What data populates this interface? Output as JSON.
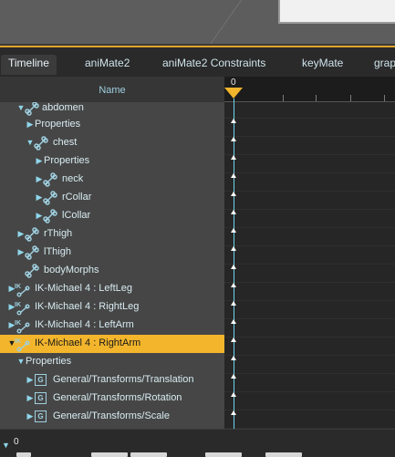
{
  "tabs": [
    {
      "label": "Timeline",
      "active": true
    },
    {
      "label": "aniMate2",
      "active": false
    },
    {
      "label": "aniMate2 Constraints",
      "active": false
    },
    {
      "label": "keyMate",
      "active": false
    },
    {
      "label": "grap",
      "active": false
    }
  ],
  "tree": {
    "header": "Name",
    "rows": [
      {
        "label": "abdomen",
        "expanded": true,
        "icon": "bone-icon"
      },
      {
        "label": "Properties",
        "expanded": false,
        "icon": ""
      },
      {
        "label": "chest",
        "expanded": true,
        "icon": "bone-icon"
      },
      {
        "label": "Properties",
        "expanded": false,
        "icon": ""
      },
      {
        "label": "neck",
        "expanded": false,
        "icon": "bone-icon"
      },
      {
        "label": "rCollar",
        "expanded": false,
        "icon": "bone-icon"
      },
      {
        "label": "lCollar",
        "expanded": false,
        "icon": "bone-icon"
      },
      {
        "label": "rThigh",
        "expanded": false,
        "icon": "bone-icon"
      },
      {
        "label": "lThigh",
        "expanded": false,
        "icon": "bone-icon"
      },
      {
        "label": "bodyMorphs",
        "expanded": false,
        "icon": "bone-icon"
      },
      {
        "label": "IK-Michael 4 : LeftLeg",
        "expanded": false,
        "icon": "ik-chain-icon"
      },
      {
        "label": "IK-Michael 4 : RightLeg",
        "expanded": false,
        "icon": "ik-chain-icon"
      },
      {
        "label": "IK-Michael 4 : LeftArm",
        "expanded": false,
        "icon": "ik-chain-icon"
      },
      {
        "label": "IK-Michael 4 : RightArm",
        "expanded": true,
        "icon": "ik-chain-icon",
        "selected": true
      },
      {
        "label": "Properties",
        "expanded": true,
        "icon": ""
      },
      {
        "label": "General/Transforms/Translation",
        "expanded": false,
        "icon": "g-property-icon"
      },
      {
        "label": "General/Transforms/Rotation",
        "expanded": false,
        "icon": "g-property-icon"
      },
      {
        "label": "General/Transforms/Scale",
        "expanded": false,
        "icon": "g-property-icon"
      }
    ]
  },
  "timeline": {
    "current_frame": "0",
    "ruler_label": "0"
  },
  "colors": {
    "accent": "#f2b52c",
    "playhead": "#6dd5ee",
    "tree_bg": "#464646",
    "timeline_bg": "#262626"
  }
}
